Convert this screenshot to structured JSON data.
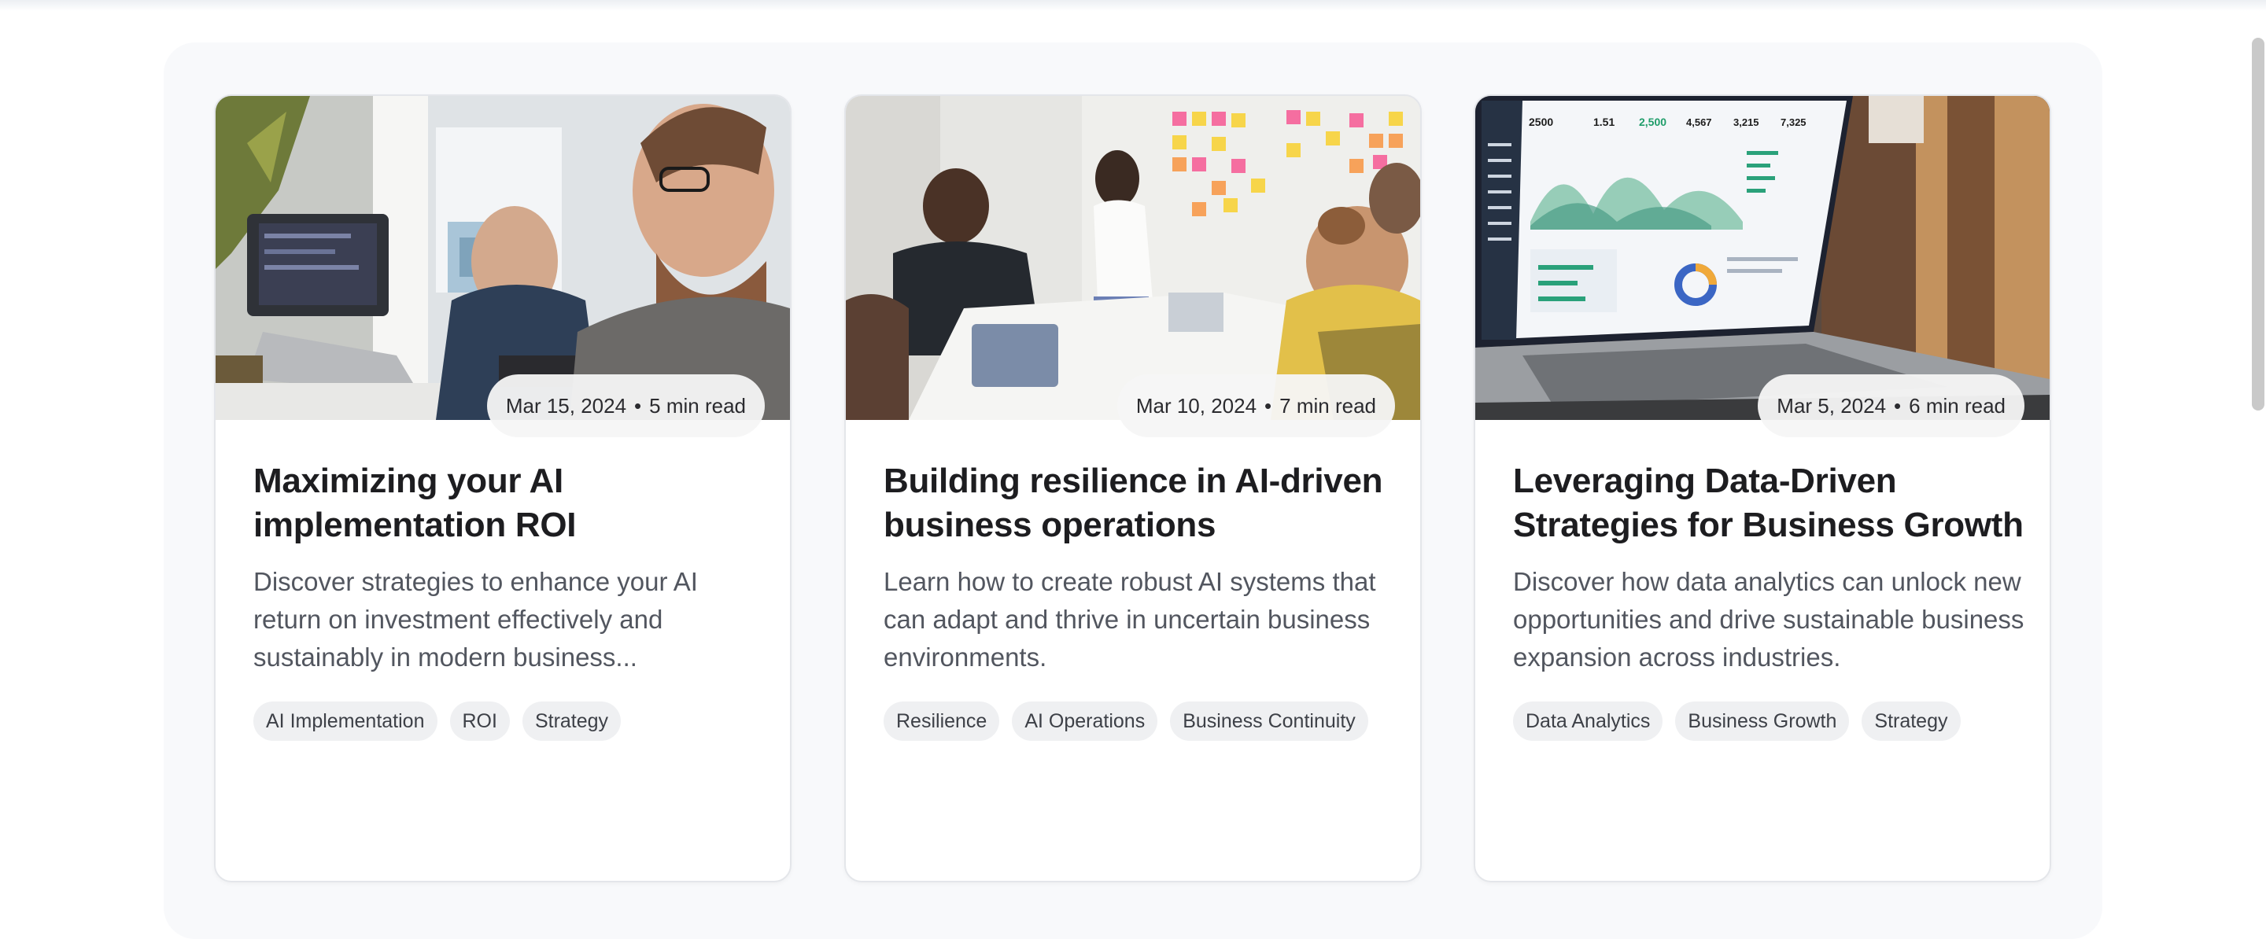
{
  "posts": [
    {
      "image": "office-developers-photo",
      "date": "Mar 15, 2024",
      "read_time": "5 min read",
      "title": "Maximizing your AI implementation ROI",
      "description": "Discover strategies to enhance your AI return on investment effectively and sustainably in modern business...",
      "tags": [
        "AI Implementation",
        "ROI",
        "Strategy"
      ]
    },
    {
      "image": "team-meeting-sticky-notes-photo",
      "date": "Mar 10, 2024",
      "read_time": "7 min read",
      "title": "Building resilience in AI-driven business operations",
      "description": "Learn how to create robust AI systems that can adapt and thrive in uncertain business environments.",
      "tags": [
        "Resilience",
        "AI Operations",
        "Business Continuity"
      ]
    },
    {
      "image": "laptop-analytics-dashboard-photo",
      "date": "Mar 5, 2024",
      "read_time": "6 min read",
      "title": "Leveraging Data-Driven Strategies for Business Growth",
      "description": "Discover how data analytics can unlock new opportunities and drive sustainable business expansion across industries.",
      "tags": [
        "Data Analytics",
        "Business Growth",
        "Strategy"
      ]
    }
  ],
  "separator": "•",
  "dashboard_numbers": [
    "2500",
    "1.51",
    "2,500",
    "4,567",
    "3,215",
    "7,325"
  ]
}
